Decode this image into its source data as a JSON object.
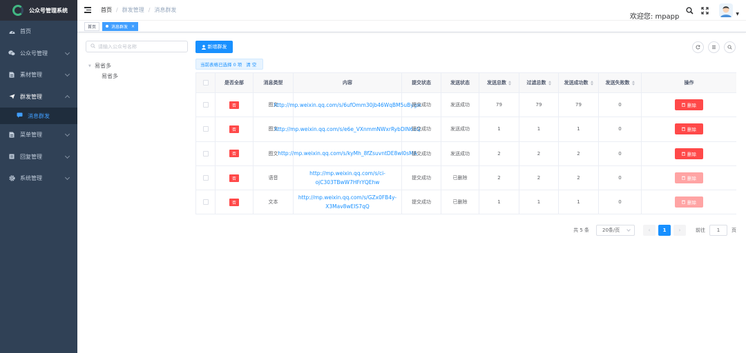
{
  "app": {
    "title": "公众号管理系统"
  },
  "sidebar": {
    "items": [
      {
        "label": "首页",
        "icon": "dashboard-icon"
      },
      {
        "label": "公众号管理",
        "icon": "wechat-icon"
      },
      {
        "label": "素材管理",
        "icon": "document-icon"
      },
      {
        "label": "群发管理",
        "icon": "send-icon"
      },
      {
        "label": "菜单管理",
        "icon": "document-icon"
      },
      {
        "label": "回复管理",
        "icon": "list-icon"
      },
      {
        "label": "系统管理",
        "icon": "gear-icon"
      }
    ],
    "active_sub": {
      "label": "消息群发",
      "icon": "message-icon"
    }
  },
  "breadcrumb": [
    "首页",
    "群发管理",
    "消息群发"
  ],
  "navbar": {
    "welcome": "欢迎您: mpapp"
  },
  "tags": [
    {
      "label": "首页",
      "active": false
    },
    {
      "label": "消息群发",
      "active": true,
      "close": "×"
    }
  ],
  "tree": {
    "search_placeholder": "请输入公众号名称",
    "root": "易省多",
    "child": "易省多"
  },
  "toolbar": {
    "add_label": "新增群发",
    "selection_text": "当前表格已选择 0 项",
    "clear_label": "清 空"
  },
  "table": {
    "headers": [
      "是否全部",
      "消息类型",
      "内容",
      "提交状态",
      "发送状态",
      "发送总数",
      "过滤总数",
      "发送成功数",
      "发送失败数",
      "操作"
    ],
    "rows": [
      {
        "all": "否",
        "type": "图文",
        "content": "http://mp.weixin.qq.com/s/6ufOmm30jb46WqBM5uBygw",
        "submit": "提交成功",
        "send": "发送成功",
        "total": "79",
        "filter": "79",
        "success": "79",
        "fail": "0",
        "action": "删除",
        "disabled": false
      },
      {
        "all": "否",
        "type": "图文",
        "content": "http://mp.weixin.qq.com/s/e6e_VXnmmNWxrRybDIN6oQ",
        "submit": "提交成功",
        "send": "发送成功",
        "total": "1",
        "filter": "1",
        "success": "1",
        "fail": "0",
        "action": "删除",
        "disabled": false
      },
      {
        "all": "否",
        "type": "图文",
        "content": "http://mp.weixin.qq.com/s/kyMh_8fZsuvntDE8wl0sMA",
        "submit": "提交成功",
        "send": "发送成功",
        "total": "2",
        "filter": "2",
        "success": "2",
        "fail": "0",
        "action": "删除",
        "disabled": false
      },
      {
        "all": "否",
        "type": "语音",
        "content": "http://mp.weixin.qq.com/s/ci-ojC303TBwW7HFrYQEhw",
        "submit": "提交成功",
        "send": "已删除",
        "total": "2",
        "filter": "2",
        "success": "2",
        "fail": "0",
        "action": "删除",
        "disabled": true
      },
      {
        "all": "否",
        "type": "文本",
        "content": "http://mp.weixin.qq.com/s/GZx0FB4y-X3Mav8wEIS7qQ",
        "submit": "提交成功",
        "send": "已删除",
        "total": "1",
        "filter": "1",
        "success": "1",
        "fail": "0",
        "action": "删除",
        "disabled": true
      }
    ]
  },
  "pagination": {
    "total": "共 5 条",
    "page_size": "20条/页",
    "current": "1",
    "goto_label": "前往",
    "goto_value": "1",
    "page_unit": "页"
  },
  "colors": {
    "sidebar_bg": "#304156",
    "primary": "#1890ff",
    "danger": "#ff4949",
    "active_menu": "#409eff"
  }
}
